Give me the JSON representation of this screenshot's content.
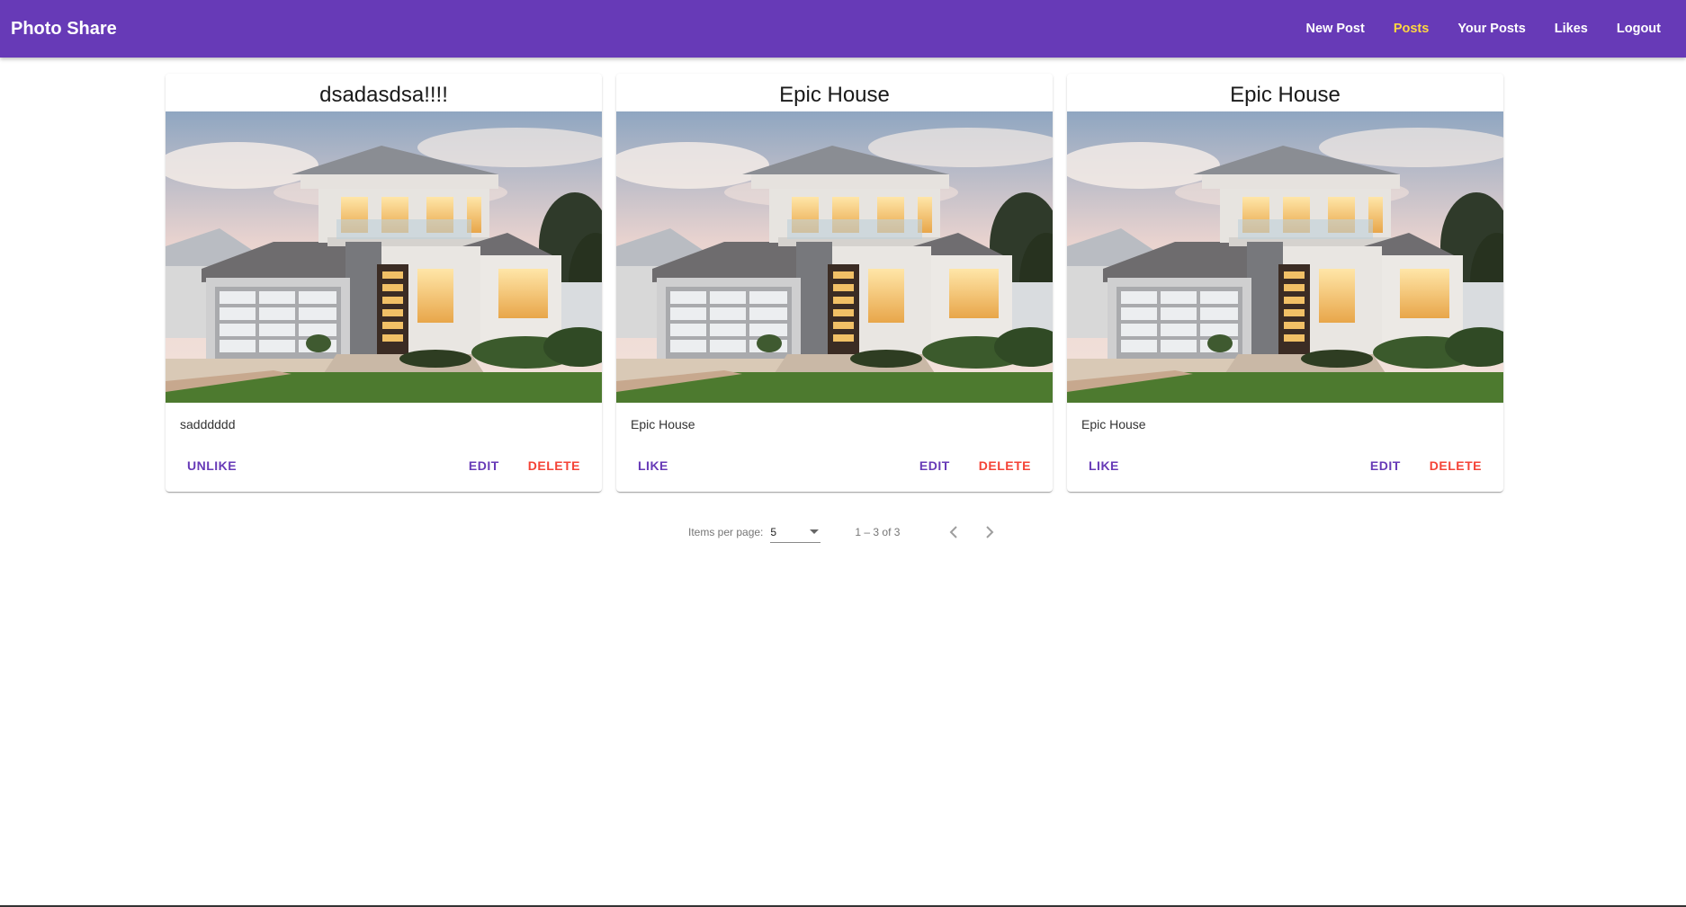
{
  "app": {
    "title": "Photo Share"
  },
  "nav": {
    "items": [
      {
        "label": "New Post"
      },
      {
        "label": "Posts"
      },
      {
        "label": "Your Posts"
      },
      {
        "label": "Likes"
      },
      {
        "label": "Logout"
      }
    ],
    "active": "Posts"
  },
  "posts": [
    {
      "title": "dsadasdsa!!!!",
      "description": "sadddddd",
      "like_label": "UNLIKE",
      "edit_label": "EDIT",
      "delete_label": "DELETE"
    },
    {
      "title": "Epic House",
      "description": "Epic House",
      "like_label": "LIKE",
      "edit_label": "EDIT",
      "delete_label": "DELETE"
    },
    {
      "title": "Epic House",
      "description": "Epic House",
      "like_label": "LIKE",
      "edit_label": "EDIT",
      "delete_label": "DELETE"
    }
  ],
  "paginator": {
    "items_per_page_label": "Items per page:",
    "items_per_page_value": "5",
    "range_label": "1 – 3 of 3"
  },
  "colors": {
    "primary": "#673ab7",
    "accent": "#ffd740",
    "warn": "#f44336"
  }
}
